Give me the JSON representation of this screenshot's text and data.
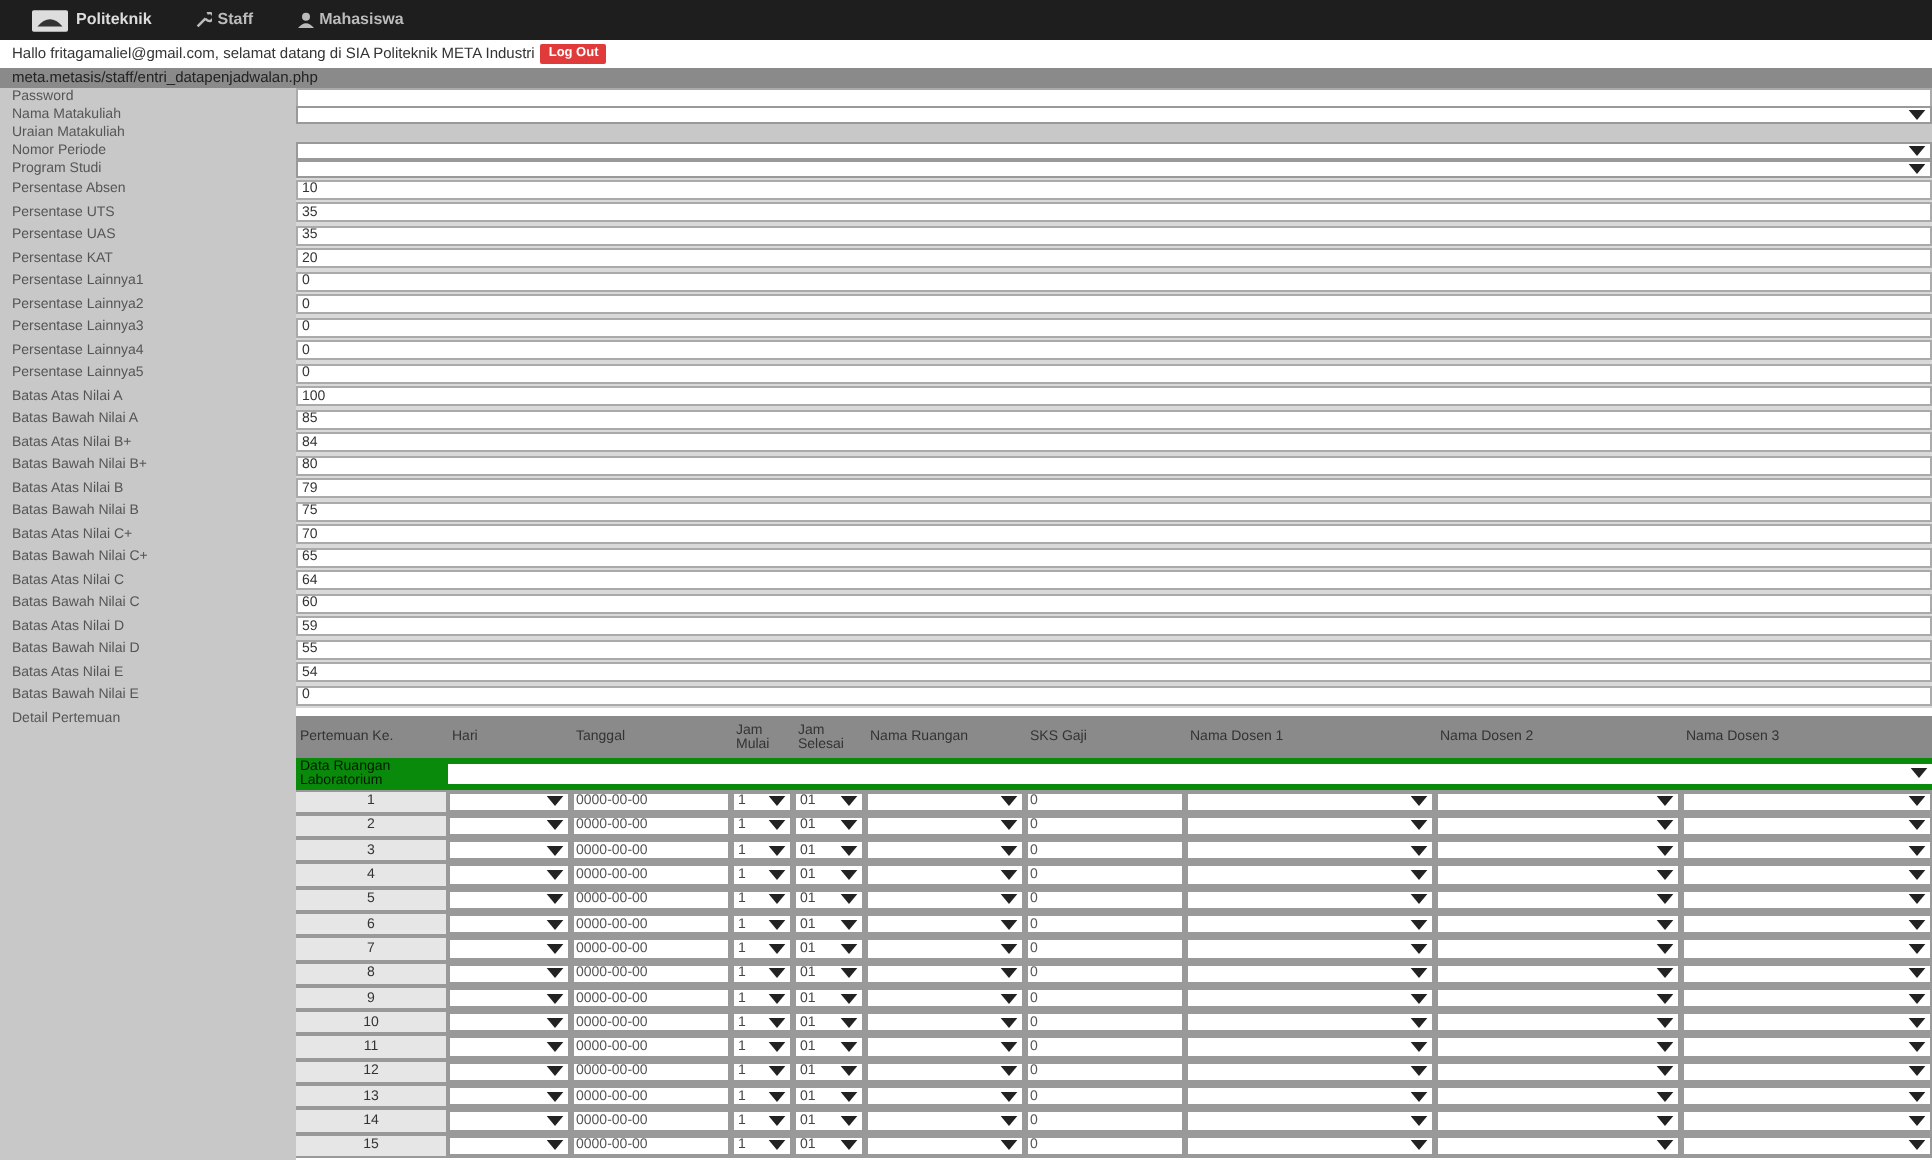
{
  "nav": {
    "brand": "Politeknik",
    "items": [
      {
        "label": "Staff",
        "kind": "staff"
      },
      {
        "label": "Mahasiswa",
        "kind": "user"
      }
    ]
  },
  "greeting": {
    "text": "Hallo fritagamaliel@gmail.com, selamat datang di SIA Politeknik META Industri",
    "logout": "Log Out"
  },
  "path_header": "meta.metasis/staff/entri_datapenjadwalan.php",
  "fields": [
    {
      "label": "Password",
      "kind": "text"
    },
    {
      "label": "Nama Matakuliah",
      "kind": "select"
    },
    {
      "label": "Uraian Matakuliah",
      "kind": "none"
    },
    {
      "label": "Nomor Periode",
      "kind": "select"
    },
    {
      "label": "Program Studi",
      "kind": "select"
    },
    {
      "label": "Persentase Absen",
      "kind": "text",
      "value": "10"
    },
    {
      "label": "Persentase UTS",
      "kind": "text",
      "value": "35"
    },
    {
      "label": "Persentase UAS",
      "kind": "text",
      "value": "35"
    },
    {
      "label": "Persentase KAT",
      "kind": "text",
      "value": "20"
    },
    {
      "label": "Persentase Lainnya1",
      "kind": "text",
      "value": "0"
    },
    {
      "label": "Persentase Lainnya2",
      "kind": "text",
      "value": "0"
    },
    {
      "label": "Persentase Lainnya3",
      "kind": "text",
      "value": "0"
    },
    {
      "label": "Persentase Lainnya4",
      "kind": "text",
      "value": "0"
    },
    {
      "label": "Persentase Lainnya5",
      "kind": "text",
      "value": "0"
    },
    {
      "label": "Batas Atas Nilai A",
      "kind": "text",
      "value": "100"
    },
    {
      "label": "Batas Bawah Nilai A",
      "kind": "text",
      "value": "85"
    },
    {
      "label": "Batas Atas Nilai B+",
      "kind": "text",
      "value": "84"
    },
    {
      "label": "Batas Bawah Nilai B+",
      "kind": "text",
      "value": "80"
    },
    {
      "label": "Batas Atas Nilai B",
      "kind": "text",
      "value": "79"
    },
    {
      "label": "Batas Bawah Nilai B",
      "kind": "text",
      "value": "75"
    },
    {
      "label": "Batas Atas Nilai C+",
      "kind": "text",
      "value": "70"
    },
    {
      "label": "Batas Bawah Nilai C+",
      "kind": "text",
      "value": "65"
    },
    {
      "label": "Batas Atas Nilai C",
      "kind": "text",
      "value": "64"
    },
    {
      "label": "Batas Bawah Nilai C",
      "kind": "text",
      "value": "60"
    },
    {
      "label": "Batas Atas Nilai D",
      "kind": "text",
      "value": "59"
    },
    {
      "label": "Batas Bawah Nilai D",
      "kind": "text",
      "value": "55"
    },
    {
      "label": "Batas Atas Nilai E",
      "kind": "text",
      "value": "54"
    },
    {
      "label": "Batas Bawah Nilai E",
      "kind": "text",
      "value": "0"
    }
  ],
  "detail": {
    "label": "Detail Pertemuan",
    "columns": [
      "Pertemuan Ke.",
      "Hari",
      "Tanggal",
      "Jam Mulai",
      "Jam Selesai",
      "Nama Ruangan",
      "SKS Gaji",
      "Nama Dosen 1",
      "Nama Dosen 2",
      "Nama Dosen 3"
    ],
    "group_row": {
      "label": "Data Ruangan Laboratorium"
    },
    "rows": [
      {
        "no": "1",
        "tanggal": "0000-00-00",
        "jam_mulai": "1",
        "jam_selesai": "01",
        "sks": "0"
      },
      {
        "no": "2",
        "tanggal": "0000-00-00",
        "jam_mulai": "1",
        "jam_selesai": "01",
        "sks": "0"
      },
      {
        "no": "3",
        "tanggal": "0000-00-00",
        "jam_mulai": "1",
        "jam_selesai": "01",
        "sks": "0"
      },
      {
        "no": "4",
        "tanggal": "0000-00-00",
        "jam_mulai": "1",
        "jam_selesai": "01",
        "sks": "0"
      },
      {
        "no": "5",
        "tanggal": "0000-00-00",
        "jam_mulai": "1",
        "jam_selesai": "01",
        "sks": "0"
      },
      {
        "no": "6",
        "tanggal": "0000-00-00",
        "jam_mulai": "1",
        "jam_selesai": "01",
        "sks": "0"
      },
      {
        "no": "7",
        "tanggal": "0000-00-00",
        "jam_mulai": "1",
        "jam_selesai": "01",
        "sks": "0"
      },
      {
        "no": "8",
        "tanggal": "0000-00-00",
        "jam_mulai": "1",
        "jam_selesai": "01",
        "sks": "0"
      },
      {
        "no": "9",
        "tanggal": "0000-00-00",
        "jam_mulai": "1",
        "jam_selesai": "01",
        "sks": "0"
      },
      {
        "no": "10",
        "tanggal": "0000-00-00",
        "jam_mulai": "1",
        "jam_selesai": "01",
        "sks": "0"
      },
      {
        "no": "11",
        "tanggal": "0000-00-00",
        "jam_mulai": "1",
        "jam_selesai": "01",
        "sks": "0"
      },
      {
        "no": "12",
        "tanggal": "0000-00-00",
        "jam_mulai": "1",
        "jam_selesai": "01",
        "sks": "0"
      },
      {
        "no": "13",
        "tanggal": "0000-00-00",
        "jam_mulai": "1",
        "jam_selesai": "01",
        "sks": "0"
      },
      {
        "no": "14",
        "tanggal": "0000-00-00",
        "jam_mulai": "1",
        "jam_selesai": "01",
        "sks": "0"
      },
      {
        "no": "15",
        "tanggal": "0000-00-00",
        "jam_mulai": "1",
        "jam_selesai": "01",
        "sks": "0"
      }
    ]
  }
}
